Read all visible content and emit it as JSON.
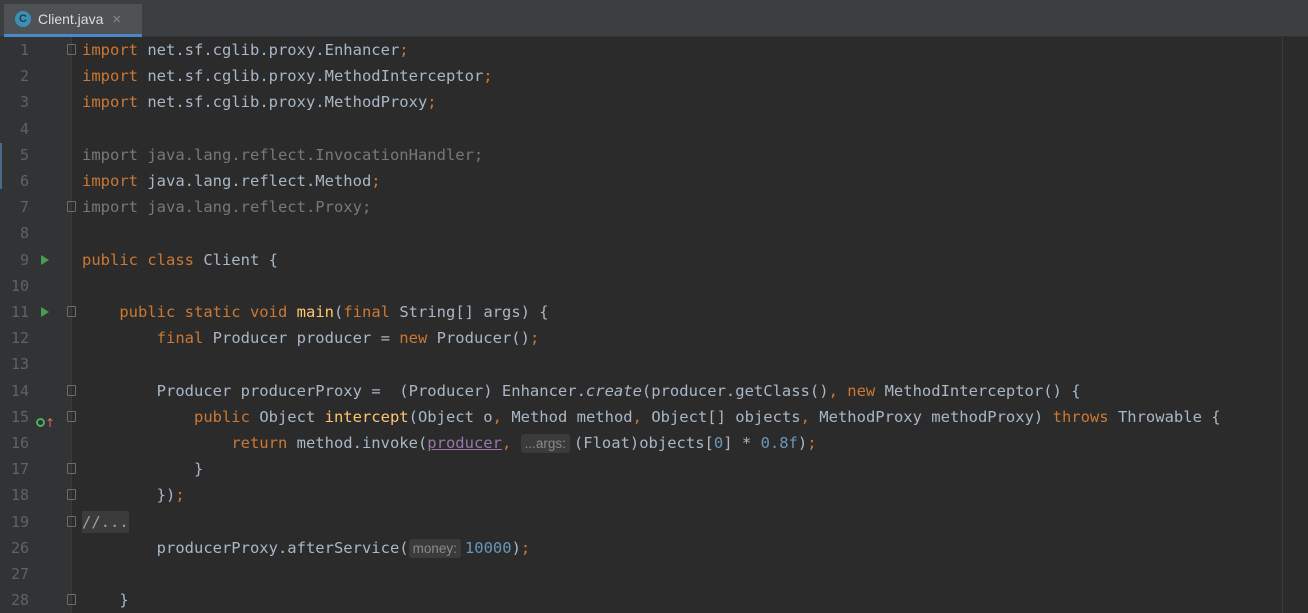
{
  "tab": {
    "title": "Client.java",
    "icon_letter": "C",
    "close": "×"
  },
  "lines": [
    {
      "n": "1",
      "fold": "⊖",
      "tokens": [
        [
          "kw",
          "import"
        ],
        [
          "txt",
          " net.sf.cglib.proxy.Enhancer"
        ],
        [
          "kw",
          ";"
        ]
      ]
    },
    {
      "n": "2",
      "tokens": [
        [
          "kw",
          "import"
        ],
        [
          "txt",
          " net.sf.cglib.proxy.MethodInterceptor"
        ],
        [
          "kw",
          ";"
        ]
      ]
    },
    {
      "n": "3",
      "tokens": [
        [
          "kw",
          "import"
        ],
        [
          "txt",
          " net.sf.cglib.proxy.MethodProxy"
        ],
        [
          "kw",
          ";"
        ]
      ]
    },
    {
      "n": "4",
      "tokens": []
    },
    {
      "n": "5",
      "tokens": [
        [
          "dim",
          "import java.lang.reflect.InvocationHandler;"
        ]
      ]
    },
    {
      "n": "6",
      "tokens": [
        [
          "kw",
          "import"
        ],
        [
          "txt",
          " java.lang.reflect.Method"
        ],
        [
          "kw",
          ";"
        ]
      ]
    },
    {
      "n": "7",
      "fold": "⊖",
      "tokens": [
        [
          "dim",
          "import java.lang.reflect.Proxy;"
        ]
      ]
    },
    {
      "n": "8",
      "tokens": []
    },
    {
      "n": "9",
      "run": true,
      "tokens": [
        [
          "kw",
          "public class"
        ],
        [
          "txt",
          " Client {"
        ]
      ]
    },
    {
      "n": "10",
      "tokens": []
    },
    {
      "n": "11",
      "run": true,
      "fold": "⊖",
      "tokens": [
        [
          "txt",
          "    "
        ],
        [
          "kw",
          "public static void"
        ],
        [
          "txt",
          " "
        ],
        [
          "fn",
          "main"
        ],
        [
          "txt",
          "("
        ],
        [
          "kw",
          "final"
        ],
        [
          "txt",
          " String[] args) {"
        ]
      ]
    },
    {
      "n": "12",
      "tokens": [
        [
          "txt",
          "        "
        ],
        [
          "kw",
          "final"
        ],
        [
          "txt",
          " Producer producer = "
        ],
        [
          "kw",
          "new"
        ],
        [
          "txt",
          " Producer()"
        ],
        [
          "kw",
          ";"
        ]
      ]
    },
    {
      "n": "13",
      "tokens": []
    },
    {
      "n": "14",
      "fold": "⊖",
      "tokens": [
        [
          "txt",
          "        Producer producerProxy =  (Producer) Enhancer."
        ],
        [
          "italic",
          "create"
        ],
        [
          "txt",
          "(producer.getClass()"
        ],
        [
          "kw",
          ","
        ],
        [
          "txt",
          " "
        ],
        [
          "kw",
          "new"
        ],
        [
          "txt",
          " MethodInterceptor() {"
        ]
      ]
    },
    {
      "n": "15",
      "impl": true,
      "fold": "⊖",
      "tokens": [
        [
          "txt",
          "            "
        ],
        [
          "kw",
          "public"
        ],
        [
          "txt",
          " Object "
        ],
        [
          "fn",
          "intercept"
        ],
        [
          "txt",
          "(Object o"
        ],
        [
          "kw",
          ","
        ],
        [
          "txt",
          " Method method"
        ],
        [
          "kw",
          ","
        ],
        [
          "txt",
          " Object[] objects"
        ],
        [
          "kw",
          ","
        ],
        [
          "txt",
          " MethodProxy methodProxy) "
        ],
        [
          "kw",
          "throws"
        ],
        [
          "txt",
          " Throwable {"
        ]
      ]
    },
    {
      "n": "16",
      "tokens": [
        [
          "txt",
          "                "
        ],
        [
          "kw",
          "return"
        ],
        [
          "txt",
          " method.invoke("
        ],
        [
          "purple",
          "producer"
        ],
        [
          "kw",
          ","
        ],
        [
          "txt",
          " "
        ],
        [
          "hint",
          "...args:"
        ],
        [
          "txt",
          "(Float)objects["
        ],
        [
          "num",
          "0"
        ],
        [
          "txt",
          "] * "
        ],
        [
          "num",
          "0.8f"
        ],
        [
          "txt",
          ")"
        ],
        [
          "kw",
          ";"
        ]
      ]
    },
    {
      "n": "17",
      "fold": "⊖",
      "tokens": [
        [
          "txt",
          "            }"
        ]
      ]
    },
    {
      "n": "18",
      "fold": "⊖",
      "tokens": [
        [
          "txt",
          "        })"
        ],
        [
          "kw",
          ";"
        ]
      ]
    },
    {
      "n": "19",
      "fold": "⊞",
      "tokens": [
        [
          "foldbox",
          "//..."
        ]
      ]
    },
    {
      "n": "26",
      "tokens": [
        [
          "txt",
          "        producerProxy.afterService("
        ],
        [
          "hint",
          "money:"
        ],
        [
          "num",
          "10000"
        ],
        [
          "txt",
          ")"
        ],
        [
          "kw",
          ";"
        ]
      ]
    },
    {
      "n": "27",
      "tokens": []
    },
    {
      "n": "28",
      "fold": "⊖",
      "tokens": [
        [
          "txt",
          "    }"
        ]
      ]
    }
  ]
}
